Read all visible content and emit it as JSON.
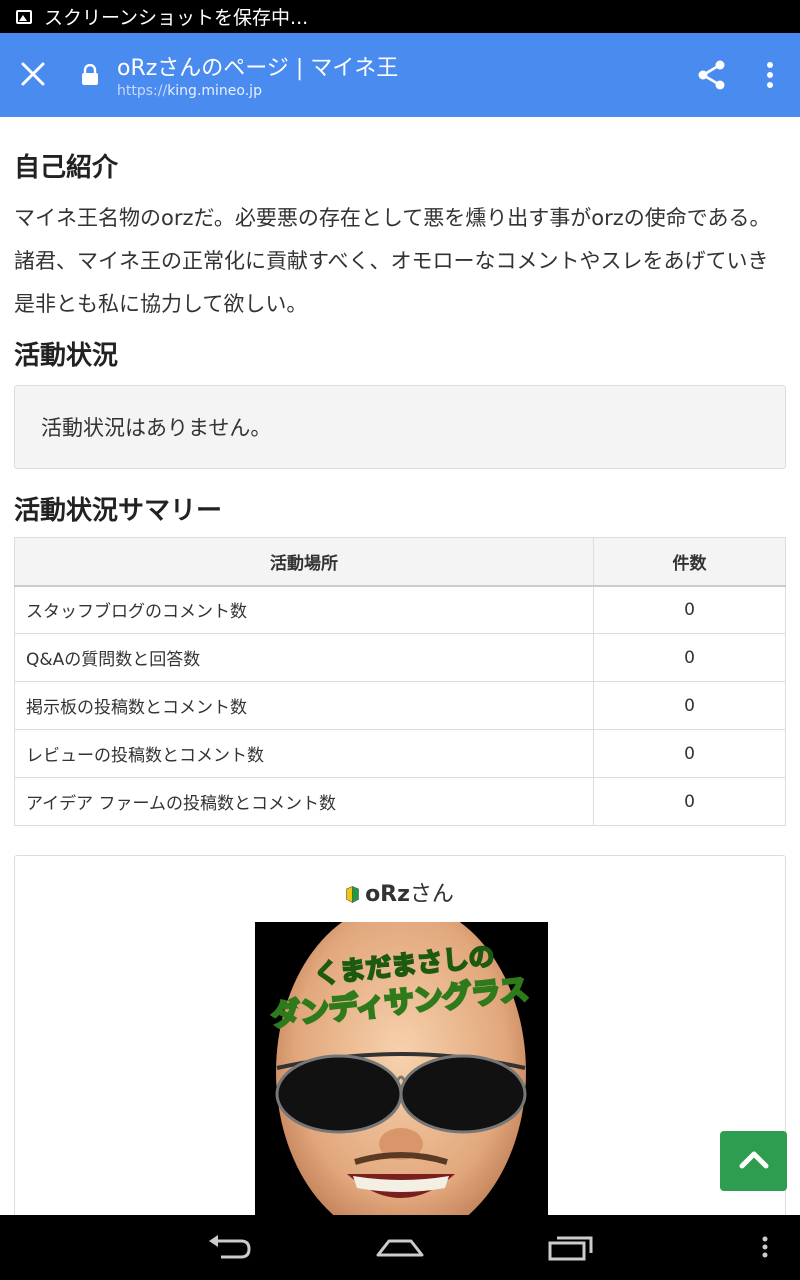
{
  "status_bar": {
    "notification": "スクリーンショットを保存中...",
    "icon": "image-icon"
  },
  "toolbar": {
    "title": "oRzさんのページ | マイネ王",
    "url_scheme": "https://",
    "url_host": "king.mineo.jp",
    "close_icon": "close-icon",
    "lock_icon": "lock-icon",
    "share_icon": "share-icon",
    "more_icon": "more-vert-icon",
    "color": "#4a8bf0"
  },
  "intro": {
    "heading": "自己紹介",
    "body": "マイネ王名物のorzだ。必要悪の存在として悪を燻り出す事がorzの使命である。諸君、マイネ王の正常化に貢献すべく、オモローなコメントやスレをあげていき是非とも私に協力して欲しい。"
  },
  "activity": {
    "heading": "活動状況",
    "empty_message": "活動状況はありません。"
  },
  "summary": {
    "heading": "活動状況サマリー",
    "columns": [
      "活動場所",
      "件数"
    ],
    "rows": [
      {
        "place": "スタッフブログのコメント数",
        "count": "0"
      },
      {
        "place": "Q&Aの質問数と回答数",
        "count": "0"
      },
      {
        "place": "掲示板の投稿数とコメント数",
        "count": "0"
      },
      {
        "place": "レビューの投稿数とコメント数",
        "count": "0"
      },
      {
        "place": "アイデア ファームの投稿数とコメント数",
        "count": "0"
      }
    ]
  },
  "profile": {
    "nickname": "oRz",
    "honorific": "さん",
    "badge_icon": "beginner-leaf-icon",
    "avatar_text_line1": "くまだまさしの",
    "avatar_text_line2": "ダンディサングラス"
  },
  "scroll_top": {
    "icon": "chevron-up-icon",
    "color": "#2e9d4f"
  },
  "navbar": {
    "back_icon": "back-icon",
    "home_icon": "home-icon",
    "recents_icon": "recents-icon",
    "menu_icon": "menu-icon"
  }
}
